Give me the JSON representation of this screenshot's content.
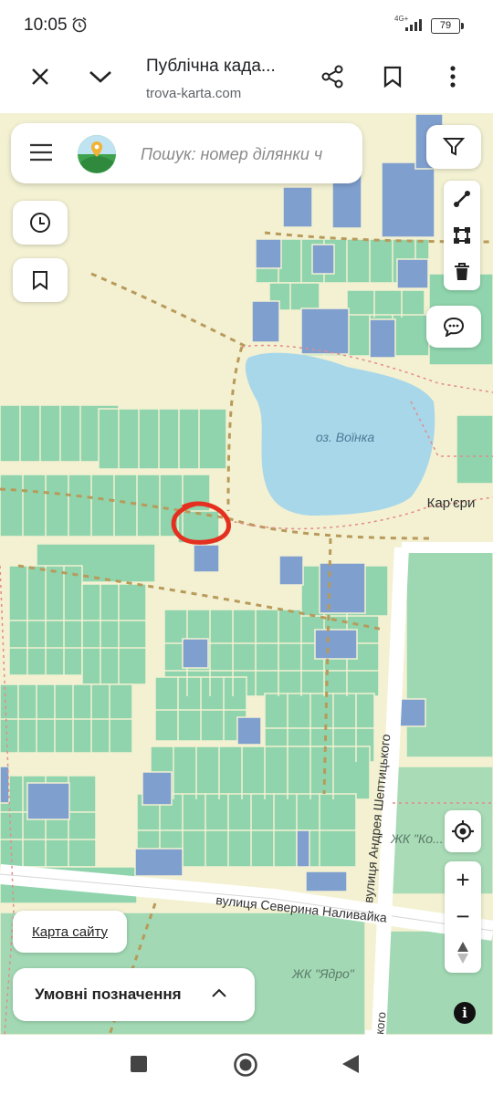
{
  "status": {
    "time": "10:05",
    "network": "4G+",
    "battery": "79"
  },
  "browser": {
    "title": "Публічна када...",
    "url": "trova-karta.com"
  },
  "search": {
    "placeholder": "Пошук: номер ділянки ч"
  },
  "map": {
    "lake_label": "оз. Воїнка",
    "place_label": "Кар'єри",
    "street_1": "вулиця Северина Наливайка",
    "street_2": "вулиця Андрея Шептицького",
    "complex_1": "ЖК \"Ядро\"",
    "complex_2": "ЖК \"Ко...",
    "street_2_tail": "кого",
    "colors": {
      "parcel_green": "#8fd4ad",
      "parcel_blue": "#7f9fcf",
      "water": "#a8d7ea",
      "background": "#f3f1d2",
      "highlight": "#e53020"
    }
  },
  "controls": {
    "sitemap": "Карта сайту",
    "legend": "Умовні позначення",
    "zoom_in": "+",
    "zoom_out": "−"
  },
  "icons": [
    "close-icon",
    "chevron-down-icon",
    "share-icon",
    "bookmark-icon",
    "more-vert-icon",
    "menu-icon",
    "filter-icon",
    "ruler-icon",
    "polygon-icon",
    "trash-icon",
    "chat-icon",
    "history-icon",
    "locate-icon",
    "compass-icon",
    "info-icon"
  ]
}
